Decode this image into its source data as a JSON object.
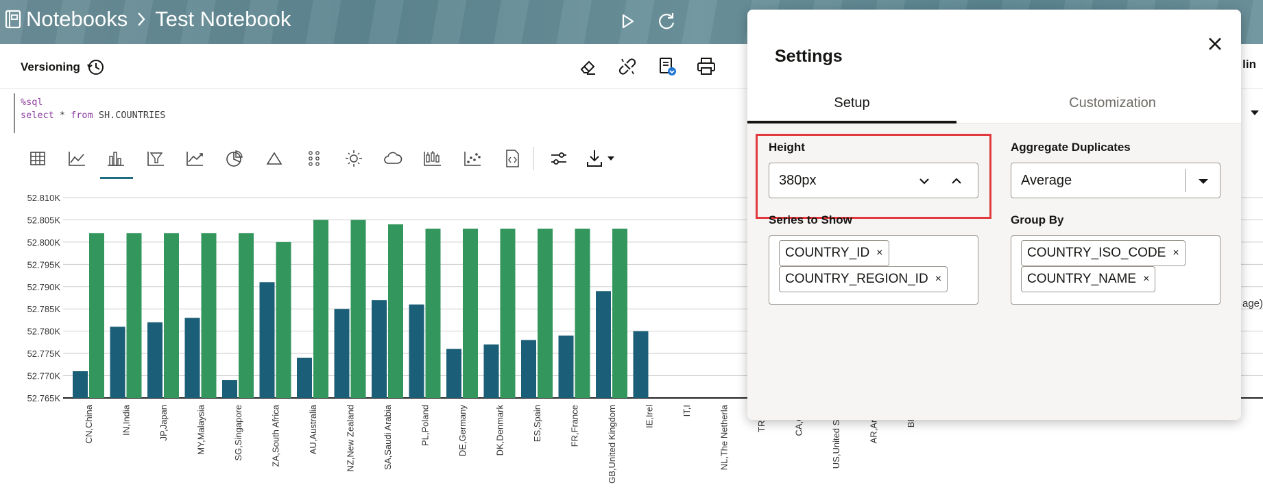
{
  "header": {
    "crumb_notebooks": "Notebooks",
    "crumb_notebook": "Test Notebook"
  },
  "toolbar": {
    "versioning_label": "Versioning",
    "cut_text": "lin"
  },
  "code": {
    "line1": "%sql",
    "line2_select": "select",
    "line2_star": " * ",
    "line2_from": "from",
    "line2_table": " SH.COUNTRIES"
  },
  "right_stub_text": "age)",
  "chart_data": {
    "type": "bar",
    "categories": [
      "CN,China",
      "IN,India",
      "JP,Japan",
      "MY,Malaysia",
      "SG,Singapore",
      "ZA,South Africa",
      "AU,Australia",
      "NZ,New Zealand",
      "SA,Saudi Arabia",
      "PL,Poland",
      "DE,Germany",
      "DK,Denmark",
      "ES,Spain",
      "FR,France",
      "GB,United Kingdom",
      "IE,Irel",
      "IT,I",
      "NL,The Netherla",
      "TR,Tur",
      "CA,Can",
      "US,United State",
      "AR,Argen",
      "BR,Bi"
    ],
    "series": [
      {
        "color": "#1b5e77",
        "values": [
          52771,
          52781,
          52782,
          52783,
          52769,
          52791,
          52774,
          52785,
          52787,
          52786,
          52776,
          52777,
          52778,
          52779,
          52789,
          52780
        ]
      },
      {
        "color": "#33965d",
        "values": [
          52802,
          52802,
          52802,
          52802,
          52802,
          52800,
          52805,
          52805,
          52804,
          52803,
          52803,
          52803,
          52803,
          52803,
          52803
        ]
      }
    ],
    "yticks": [
      "52.810K",
      "52.805K",
      "52.800K",
      "52.795K",
      "52.790K",
      "52.785K",
      "52.780K",
      "52.775K",
      "52.770K",
      "52.765K"
    ],
    "ylim": [
      52765,
      52810
    ],
    "grid": true
  },
  "settings": {
    "title": "Settings",
    "tabs": [
      "Setup",
      "Customization"
    ],
    "height_label": "Height",
    "height_value": "380px",
    "aggregate_label": "Aggregate Duplicates",
    "aggregate_value": "Average",
    "series_label": "Series to Show",
    "series_chips": [
      "COUNTRY_ID",
      "COUNTRY_REGION_ID"
    ],
    "groupby_label": "Group By",
    "groupby_chips": [
      "COUNTRY_ISO_CODE",
      "COUNTRY_NAME"
    ],
    "chip_remove": "×"
  }
}
